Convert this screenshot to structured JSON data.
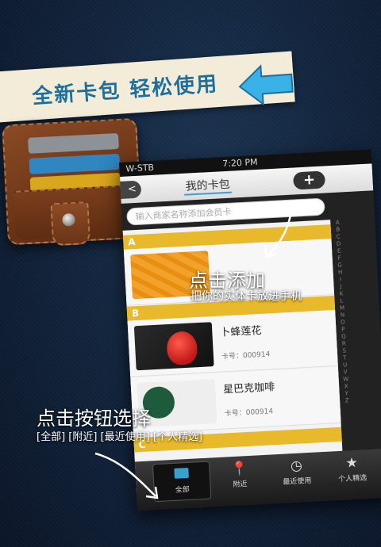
{
  "banner": {
    "text": "全新卡包 轻松使用"
  },
  "phone": {
    "carrier": "W-STB",
    "time": "7:20 PM",
    "title": "我的卡包",
    "back_label": "<",
    "add_label": "+",
    "search_placeholder": "输入商家名称添加会员卡",
    "sections": [
      {
        "letter": "A"
      },
      {
        "letter": "B"
      },
      {
        "letter": "C"
      }
    ],
    "cards": [
      {
        "merchant": "",
        "card_number": ""
      },
      {
        "merchant": "卜蜂莲花",
        "card_number": "卡号：000914"
      },
      {
        "merchant": "星巴克咖啡",
        "card_number": "卡号：000914"
      }
    ],
    "tabs": [
      {
        "label": "全部",
        "icon": "wallet-icon"
      },
      {
        "label": "附近",
        "icon": "location-pin-icon"
      },
      {
        "label": "最近使用",
        "icon": "clock-icon"
      },
      {
        "label": "个人精选",
        "icon": "star-icon"
      }
    ]
  },
  "overlay": {
    "add_title": "点击添加",
    "add_subtitle": "把你的实体卡放进手机",
    "tabs_title": "点击按钮选择",
    "tabs_subtitle": "[全部] [附近] [最近使用] [个人精选]"
  },
  "colors": {
    "banner_text": "#1f6f9c",
    "section_bar": "#e8b92a",
    "accent": "#3aa0d0"
  }
}
